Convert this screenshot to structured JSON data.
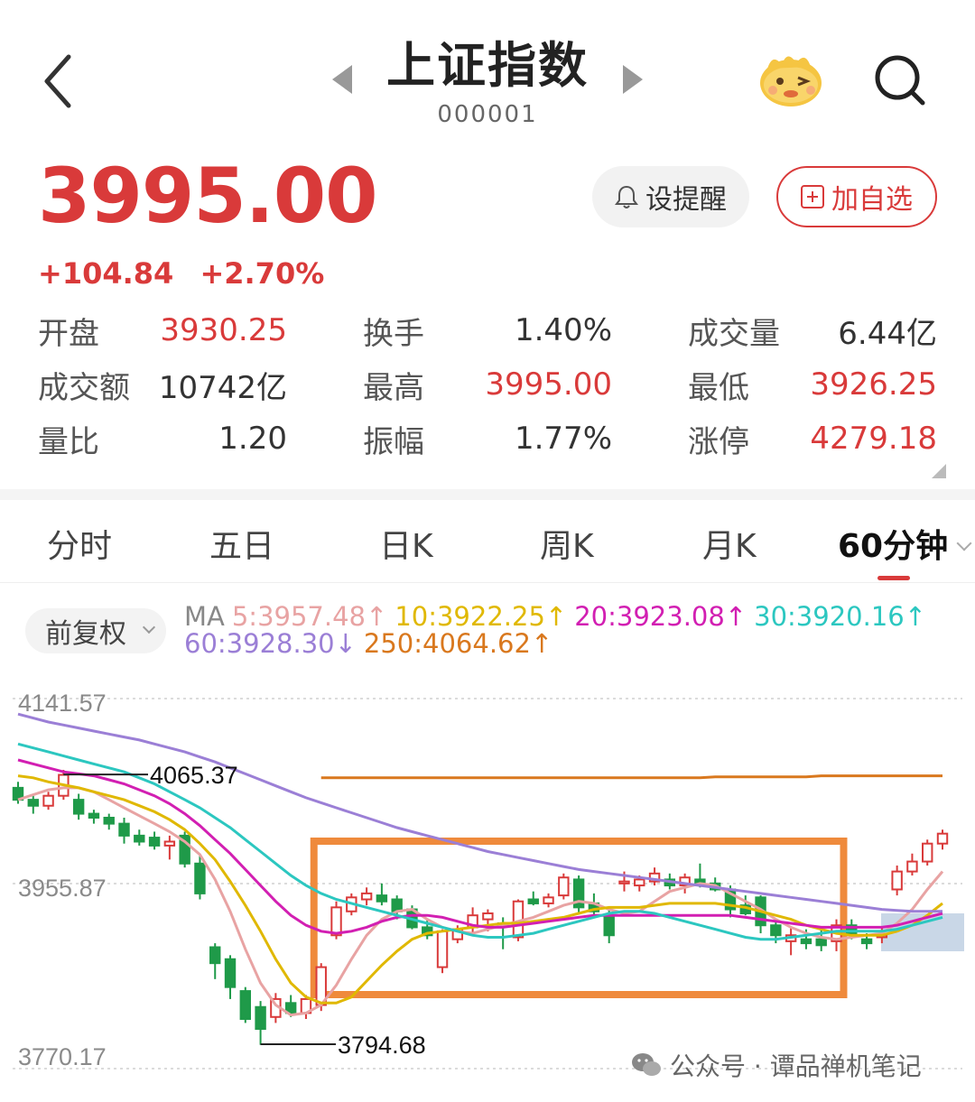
{
  "header": {
    "title": "上证指数",
    "code": "000001"
  },
  "quote": {
    "price": "3995.00",
    "change": "+104.84",
    "change_pct": "+2.70%"
  },
  "actions": {
    "alert_label": "设提醒",
    "watch_label": "加自选"
  },
  "stats": [
    [
      {
        "label": "开盘",
        "value": "3930.25",
        "color": "red"
      },
      {
        "label": "换手",
        "value": "1.40%",
        "color": "neutral"
      },
      {
        "label": "成交量",
        "value": "6.44亿",
        "color": "neutral"
      }
    ],
    [
      {
        "label": "成交额",
        "value": "10742亿",
        "color": "neutral"
      },
      {
        "label": "最高",
        "value": "3995.00",
        "color": "red"
      },
      {
        "label": "最低",
        "value": "3926.25",
        "color": "red"
      }
    ],
    [
      {
        "label": "量比",
        "value": "1.20",
        "color": "neutral"
      },
      {
        "label": "振幅",
        "value": "1.77%",
        "color": "neutral"
      },
      {
        "label": "涨停",
        "value": "4279.18",
        "color": "red"
      }
    ]
  ],
  "tabs": [
    "分时",
    "五日",
    "日K",
    "周K",
    "月K",
    "60分钟"
  ],
  "active_tab": "60分钟",
  "adjust_label": "前复权",
  "ma": {
    "prefix": "MA",
    "items": [
      {
        "text": "5:3957.48↑",
        "color": "#e8a3a3"
      },
      {
        "text": "10:3922.25↑",
        "color": "#e0b800"
      },
      {
        "text": "20:3923.08↑",
        "color": "#d21fb2"
      },
      {
        "text": "30:3920.16↑",
        "color": "#2cc7c0"
      },
      {
        "text": "60:3928.30↓",
        "color": "#9b7fd6"
      },
      {
        "text": "250:4064.62↑",
        "color": "#d9781e"
      }
    ]
  },
  "colors": {
    "up": "#d93a3a",
    "down": "#1f9a49",
    "highlight_box": "#ef8a3c"
  },
  "chart_data": {
    "type": "candlestick",
    "ylim": [
      3770.17,
      4141.57
    ],
    "y_ticks": [
      "4141.57",
      "3955.87",
      "3770.17"
    ],
    "annotations": {
      "high": "4065.37",
      "low": "3794.68"
    },
    "candles": [
      [
        4052,
        4058,
        4036,
        4040
      ],
      [
        4040,
        4044,
        4026,
        4034
      ],
      [
        4034,
        4048,
        4030,
        4044
      ],
      [
        4044,
        4070,
        4040,
        4065
      ],
      [
        4040,
        4046,
        4020,
        4026
      ],
      [
        4026,
        4030,
        4016,
        4022
      ],
      [
        4022,
        4026,
        4010,
        4016
      ],
      [
        4016,
        4022,
        3996,
        4004
      ],
      [
        4004,
        4010,
        3994,
        3998
      ],
      [
        4002,
        4008,
        3990,
        3994
      ],
      [
        3994,
        4004,
        3980,
        3998
      ],
      [
        4004,
        4008,
        3972,
        3976
      ],
      [
        3976,
        3984,
        3940,
        3946
      ],
      [
        3892,
        3896,
        3860,
        3876
      ],
      [
        3880,
        3884,
        3840,
        3852
      ],
      [
        3848,
        3852,
        3816,
        3820
      ],
      [
        3832,
        3838,
        3794,
        3810
      ],
      [
        3822,
        3846,
        3816,
        3840
      ],
      [
        3836,
        3844,
        3822,
        3826
      ],
      [
        3826,
        3844,
        3820,
        3840
      ],
      [
        3834,
        3876,
        3828,
        3872
      ],
      [
        3904,
        3938,
        3900,
        3932
      ],
      [
        3928,
        3946,
        3924,
        3942
      ],
      [
        3940,
        3952,
        3934,
        3946
      ],
      [
        3944,
        3956,
        3934,
        3938
      ],
      [
        3940,
        3944,
        3920,
        3928
      ],
      [
        3930,
        3934,
        3910,
        3912
      ],
      [
        3912,
        3920,
        3900,
        3904
      ],
      [
        3872,
        3910,
        3866,
        3908
      ],
      [
        3900,
        3914,
        3896,
        3910
      ],
      [
        3912,
        3932,
        3906,
        3924
      ],
      [
        3920,
        3930,
        3908,
        3926
      ],
      [
        3916,
        3922,
        3890,
        3914
      ],
      [
        3902,
        3940,
        3898,
        3938
      ],
      [
        3940,
        3948,
        3934,
        3936
      ],
      [
        3936,
        3946,
        3932,
        3942
      ],
      [
        3944,
        3966,
        3940,
        3962
      ],
      [
        3960,
        3964,
        3926,
        3932
      ],
      [
        3936,
        3946,
        3924,
        3928
      ],
      [
        3924,
        3930,
        3896,
        3904
      ],
      [
        3956,
        3968,
        3948,
        3958
      ],
      [
        3954,
        3964,
        3948,
        3960
      ],
      [
        3958,
        3972,
        3954,
        3966
      ],
      [
        3960,
        3966,
        3950,
        3954
      ],
      [
        3954,
        3966,
        3946,
        3962
      ],
      [
        3960,
        3976,
        3952,
        3956
      ],
      [
        3956,
        3962,
        3948,
        3950
      ],
      [
        3950,
        3954,
        3922,
        3930
      ],
      [
        3934,
        3944,
        3924,
        3926
      ],
      [
        3942,
        3944,
        3906,
        3914
      ],
      [
        3914,
        3920,
        3896,
        3904
      ],
      [
        3898,
        3912,
        3884,
        3904
      ],
      [
        3900,
        3910,
        3890,
        3896
      ],
      [
        3900,
        3912,
        3888,
        3894
      ],
      [
        3898,
        3920,
        3888,
        3914
      ],
      [
        3914,
        3920,
        3900,
        3906
      ],
      [
        3900,
        3906,
        3890,
        3896
      ],
      [
        3902,
        3912,
        3896,
        3904
      ],
      [
        3950,
        3974,
        3944,
        3968
      ],
      [
        3968,
        3986,
        3964,
        3978
      ],
      [
        3978,
        4000,
        3974,
        3996
      ],
      [
        3996,
        4010,
        3990,
        4006
      ]
    ],
    "ma_series": [
      {
        "name": "MA5",
        "color": "#e8a3a3",
        "values": [
          4040,
          4045,
          4050,
          4052,
          4052,
          4048,
          4040,
          4032,
          4024,
          4016,
          4008,
          3998,
          3985,
          3960,
          3928,
          3890,
          3856,
          3834,
          3824,
          3826,
          3834,
          3854,
          3880,
          3904,
          3920,
          3928,
          3930,
          3920,
          3912,
          3908,
          3906,
          3910,
          3914,
          3918,
          3922,
          3928,
          3934,
          3938,
          3936,
          3930,
          3926,
          3928,
          3938,
          3948,
          3952,
          3956,
          3954,
          3946,
          3938,
          3930,
          3920,
          3912,
          3906,
          3902,
          3900,
          3902,
          3904,
          3906,
          3916,
          3930,
          3950,
          3968
        ]
      },
      {
        "name": "MA10",
        "color": "#e0b800",
        "values": [
          4064,
          4062,
          4058,
          4055,
          4052,
          4048,
          4044,
          4040,
          4034,
          4028,
          4020,
          4010,
          3996,
          3980,
          3958,
          3934,
          3908,
          3880,
          3856,
          3842,
          3836,
          3836,
          3842,
          3858,
          3874,
          3888,
          3900,
          3906,
          3908,
          3910,
          3912,
          3914,
          3916,
          3916,
          3918,
          3920,
          3922,
          3926,
          3930,
          3932,
          3932,
          3932,
          3934,
          3936,
          3936,
          3936,
          3936,
          3934,
          3932,
          3928,
          3924,
          3920,
          3914,
          3910,
          3906,
          3904,
          3904,
          3904,
          3908,
          3914,
          3924,
          3936
        ]
      },
      {
        "name": "MA20",
        "color": "#d21fb2",
        "values": [
          4080,
          4076,
          4072,
          4068,
          4066,
          4064,
          4060,
          4056,
          4050,
          4044,
          4036,
          4026,
          4014,
          4000,
          3986,
          3970,
          3954,
          3938,
          3924,
          3914,
          3908,
          3906,
          3908,
          3912,
          3918,
          3922,
          3924,
          3924,
          3922,
          3918,
          3914,
          3912,
          3912,
          3914,
          3916,
          3918,
          3920,
          3922,
          3924,
          3924,
          3924,
          3924,
          3924,
          3924,
          3924,
          3924,
          3924,
          3924,
          3922,
          3920,
          3918,
          3916,
          3914,
          3912,
          3912,
          3912,
          3912,
          3912,
          3914,
          3918,
          3922,
          3926
        ]
      },
      {
        "name": "MA30",
        "color": "#2cc7c0",
        "values": [
          4096,
          4092,
          4088,
          4084,
          4080,
          4076,
          4072,
          4068,
          4062,
          4056,
          4048,
          4040,
          4032,
          4022,
          4012,
          4000,
          3988,
          3976,
          3964,
          3954,
          3946,
          3940,
          3936,
          3932,
          3928,
          3924,
          3920,
          3916,
          3912,
          3908,
          3904,
          3902,
          3902,
          3904,
          3906,
          3910,
          3914,
          3918,
          3922,
          3926,
          3928,
          3928,
          3926,
          3922,
          3918,
          3914,
          3910,
          3906,
          3902,
          3900,
          3900,
          3902,
          3904,
          3906,
          3908,
          3908,
          3908,
          3908,
          3910,
          3914,
          3918,
          3922
        ]
      },
      {
        "name": "MA60",
        "color": "#9b7fd6",
        "values": [
          4126,
          4122,
          4118,
          4115,
          4112,
          4109,
          4106,
          4103,
          4100,
          4096,
          4092,
          4088,
          4083,
          4078,
          4072,
          4066,
          4060,
          4054,
          4048,
          4042,
          4037,
          4032,
          4027,
          4022,
          4017,
          4012,
          4008,
          4004,
          4000,
          3996,
          3992,
          3988,
          3985,
          3982,
          3979,
          3976,
          3973,
          3970,
          3968,
          3966,
          3964,
          3962,
          3960,
          3958,
          3956,
          3954,
          3952,
          3950,
          3948,
          3946,
          3944,
          3942,
          3940,
          3938,
          3936,
          3934,
          3932,
          3930,
          3929,
          3928,
          3928,
          3928
        ]
      },
      {
        "name": "MA250",
        "color": "#d9781e",
        "start": 20,
        "values": [
          4062,
          4062,
          4062,
          4062,
          4062,
          4062,
          4062,
          4062,
          4062,
          4062,
          4062,
          4062,
          4062,
          4062,
          4062,
          4062,
          4062,
          4062,
          4062,
          4062,
          4062,
          4062,
          4062,
          4062,
          4062,
          4062,
          4063,
          4063,
          4063,
          4063,
          4063,
          4063,
          4063,
          4064,
          4064,
          4064,
          4064,
          4064,
          4064,
          4064,
          4064,
          4064
        ]
      }
    ],
    "highlight_range": [
      20,
      54
    ]
  },
  "watermark": "公众号 · 谭品禅机笔记"
}
